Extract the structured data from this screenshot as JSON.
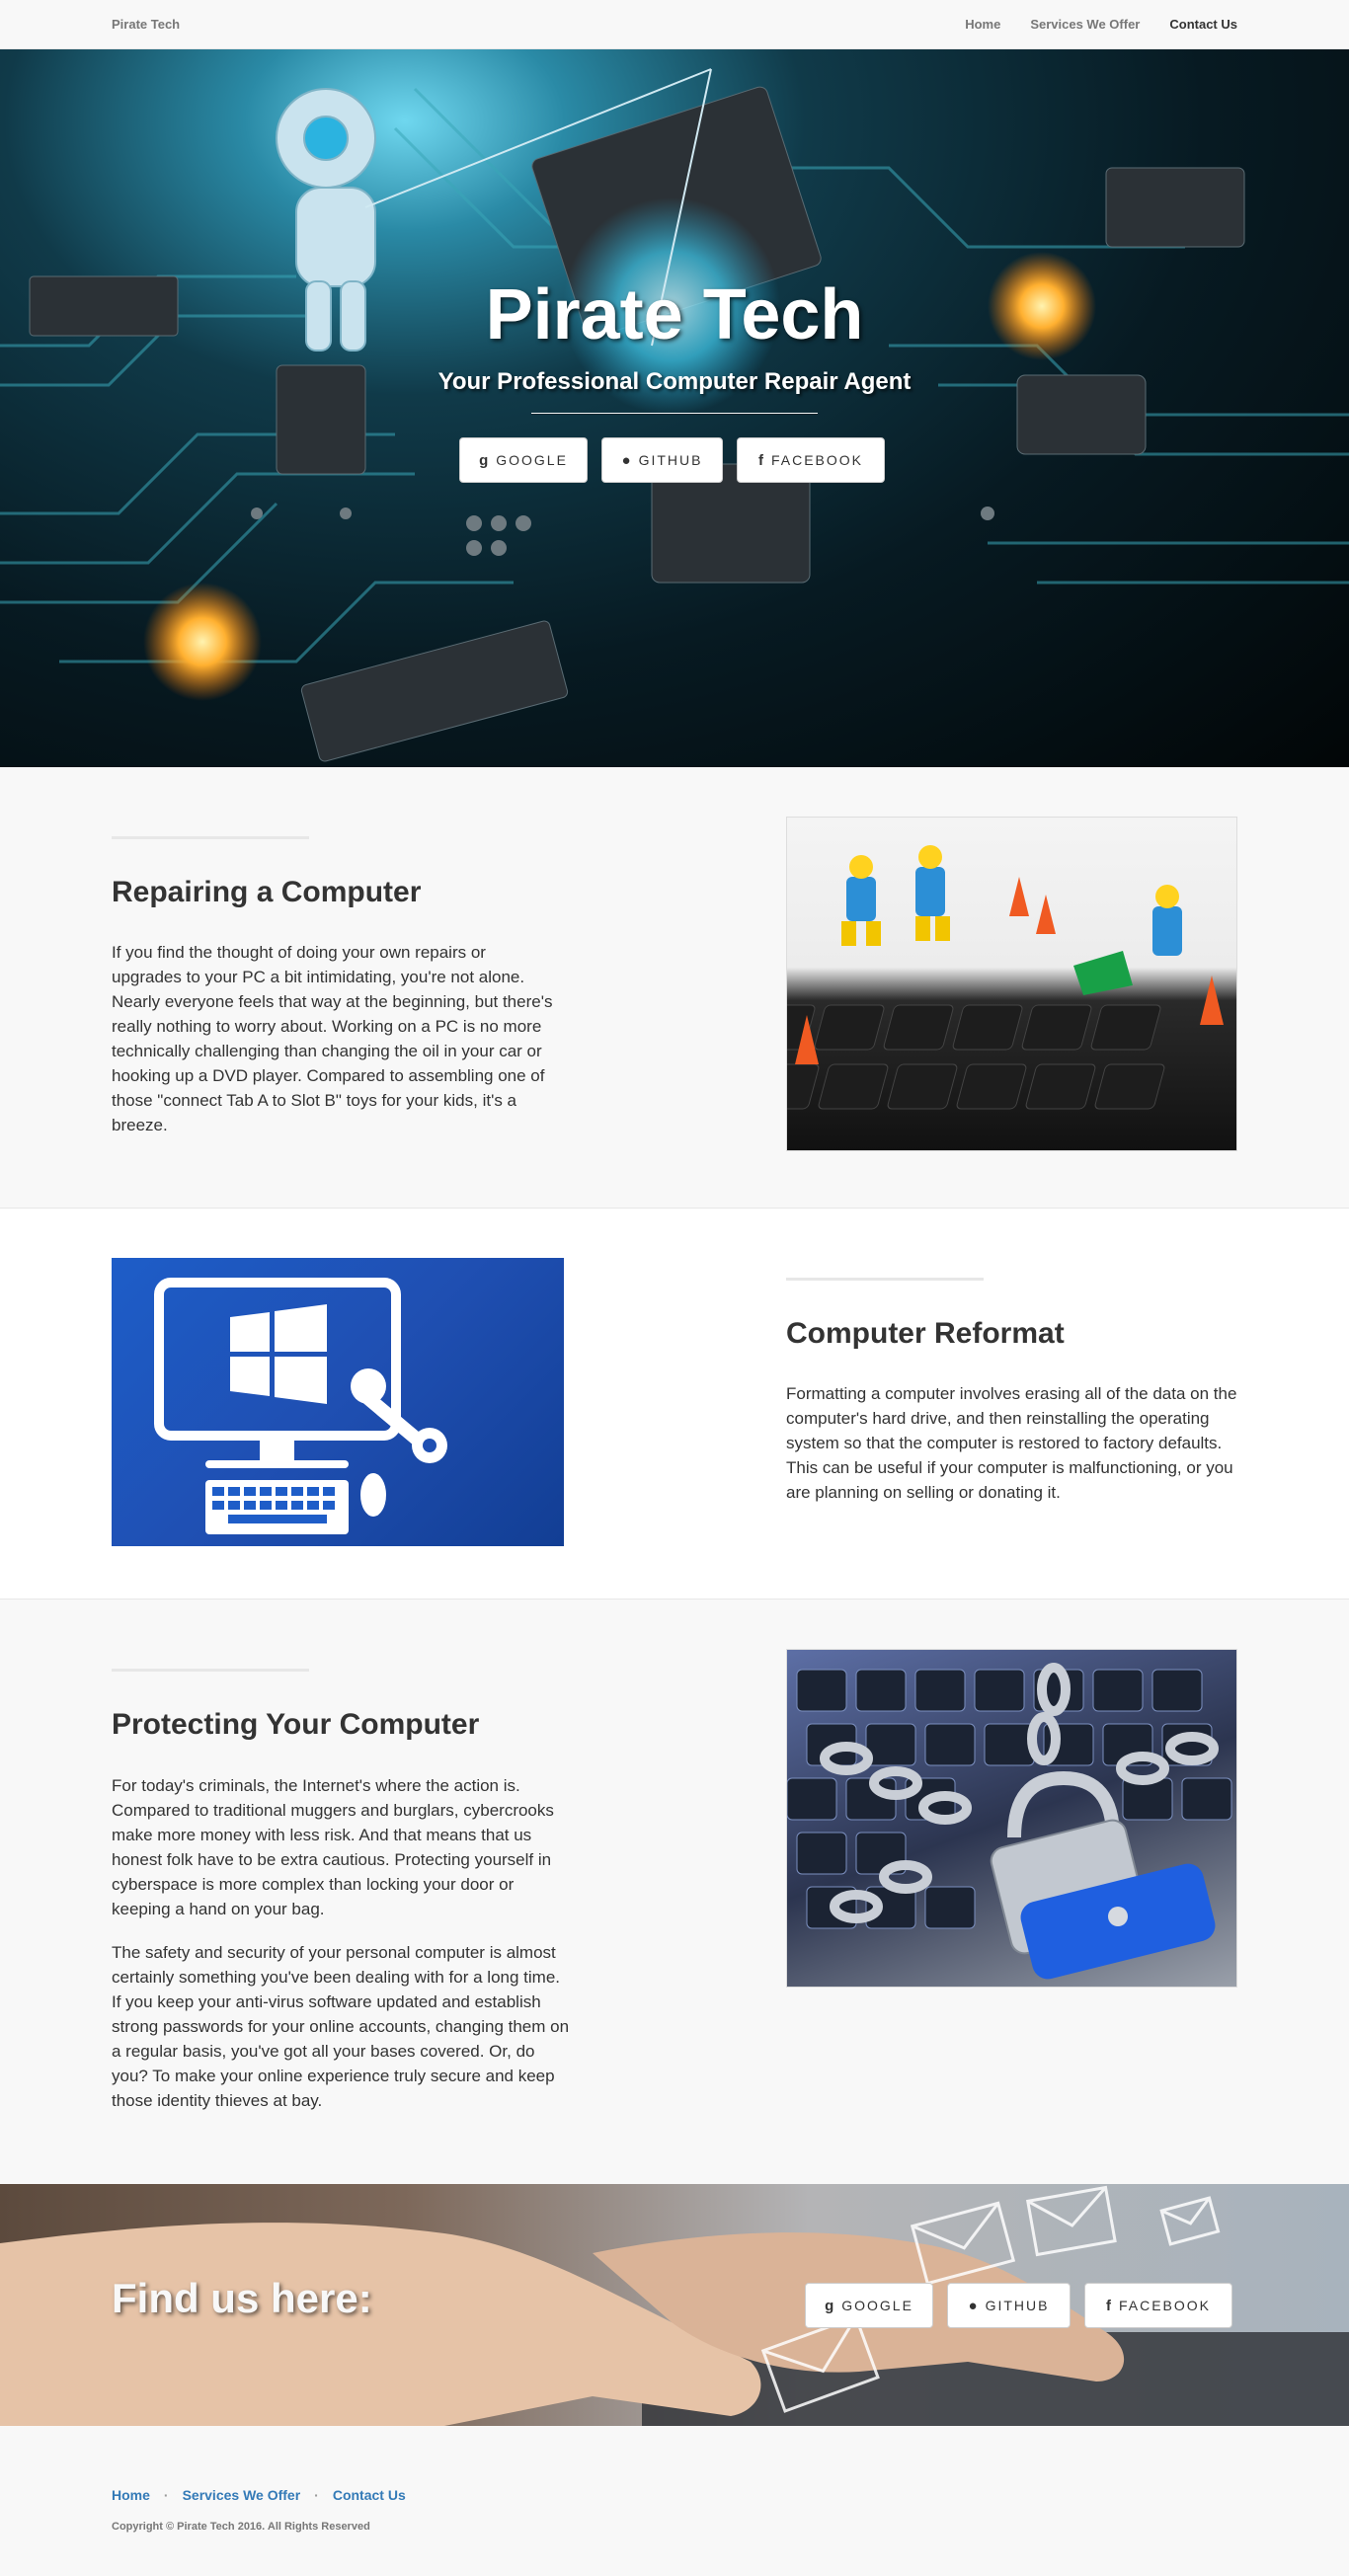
{
  "navbar": {
    "brand": "Pirate Tech",
    "links": [
      "Home",
      "Services We Offer",
      "Contact Us"
    ]
  },
  "hero": {
    "title": "Pirate Tech",
    "subtitle": "Your Professional Computer Repair Agent",
    "buttons": [
      {
        "icon": "google-icon",
        "label": "GOOGLE"
      },
      {
        "icon": "github-icon",
        "label": "GITHUB"
      },
      {
        "icon": "facebook-icon",
        "label": "FACEBOOK"
      }
    ]
  },
  "sections": [
    {
      "heading": "Repairing a Computer",
      "paragraphs": [
        "If you find the thought of doing your own repairs or upgrades to your PC a bit intimidating, you're not alone. Nearly everyone feels that way at the beginning, but there's really nothing to worry about. Working on a PC is no more technically challenging than changing the oil in your car or hooking up a DVD player. Compared to assembling one of those \"connect Tab A to Slot B\" toys for your kids, it's a breeze."
      ]
    },
    {
      "heading": "Computer Reformat",
      "paragraphs": [
        "Formatting a computer involves erasing all of the data on the computer's hard drive, and then reinstalling the operating system so that the computer is restored to factory defaults. This can be useful if your computer is malfunctioning, or you are planning on selling or donating it."
      ]
    },
    {
      "heading": "Protecting Your Computer",
      "paragraphs": [
        "For today's criminals, the Internet's where the action is. Compared to traditional muggers and burglars, cybercrooks make more money with less risk. And that means that us honest folk have to be extra cautious. Protecting yourself in cyberspace is more complex than locking your door or keeping a hand on your bag.",
        "The safety and security of your personal computer is almost certainly something you've been dealing with for a long time. If you keep your anti-virus software updated and establish strong passwords for your online accounts, changing them on a regular basis, you've got all your bases covered. Or, do you? To make your online experience truly secure and keep those identity thieves at bay."
      ]
    }
  ],
  "banner": {
    "title": "Find us here:",
    "buttons": [
      {
        "icon": "google-icon",
        "label": "GOOGLE"
      },
      {
        "icon": "github-icon",
        "label": "GITHUB"
      },
      {
        "icon": "facebook-icon",
        "label": "FACEBOOK"
      }
    ]
  },
  "footer": {
    "links": [
      "Home",
      "Services We Offer",
      "Contact Us"
    ],
    "separator": "·",
    "copyright": "Copyright © Pirate Tech 2016. All Rights Reserved"
  },
  "colors": {
    "link": "#337ab7",
    "navbar_bg": "#f8f8f8",
    "text": "#333333"
  }
}
